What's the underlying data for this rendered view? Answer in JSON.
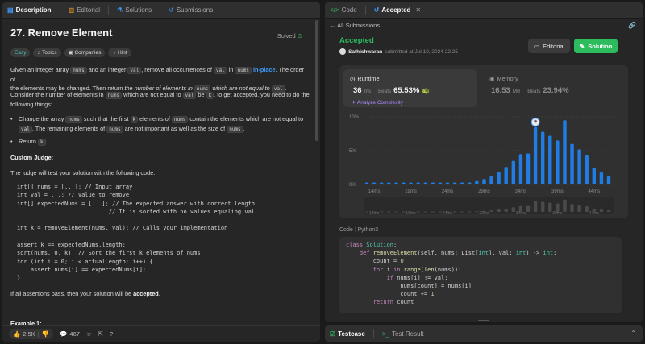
{
  "left": {
    "tabs": [
      "Description",
      "Editorial",
      "Solutions",
      "Submissions"
    ],
    "title": "27. Remove Element",
    "solved": "Solved",
    "tags": [
      "Easy",
      "Topics",
      "Companies",
      "Hint"
    ],
    "p1": {
      "a": "Given an integer array ",
      "c1": "nums",
      "b": " and an integer ",
      "c2": "val",
      "c": ", remove all occurrences of ",
      "c3": "val",
      "d": " in ",
      "c4": "nums",
      "e": " in-place",
      "f": ". The order of",
      "g": "the elements may be changed. Then return ",
      "h": "the number of elements in ",
      "c5": "nums",
      "i": " which are not equal to ",
      "c6": "val",
      "j": "."
    },
    "p2": {
      "a": "Consider the number of elements in ",
      "c1": "nums",
      "b": " which are not equal to ",
      "c2": "val",
      "c": " be ",
      "c3": "k",
      "d": ", to get accepted, you need to do the",
      "e": "following things:"
    },
    "bullet1": {
      "a": "Change the array ",
      "c1": "nums",
      "b": " such that the first ",
      "c2": "k",
      "c": " elements of ",
      "c3": "nums",
      "d": " contain the elements which are not equal to",
      "c4": "val",
      "e": ". The remaining elements of ",
      "c5": "nums",
      "f": " are not important as well as the size of ",
      "c6": "nums",
      "g": "."
    },
    "bullet2": {
      "a": "Return ",
      "c1": "k",
      "b": "."
    },
    "custom_judge": "Custom Judge:",
    "judge_text": "The judge will test your solution with the following code:",
    "judge_code": [
      "int[] nums = [...]; // Input array",
      "int val = ...; // Value to remove",
      "int[] expectedNums = [...]; // The expected answer with correct length.",
      "                           // It is sorted with no values equaling val.",
      "",
      "int k = removeElement(nums, val); // Calls your implementation",
      "",
      "assert k == expectedNums.length;",
      "sort(nums, 0, k); // Sort the first k elements of nums",
      "for (int i = 0; i < actualLength; i++) {",
      "    assert nums[i] == expectedNums[i];",
      "}"
    ],
    "pass_a": "If all assertions pass, then your solution will be ",
    "pass_b": "accepted",
    "pass_c": ".",
    "example": "Example 1:",
    "likes": "2.5K",
    "comments": "467"
  },
  "right": {
    "tabs": [
      "Code",
      "Accepted"
    ],
    "back": "All Submissions",
    "status": "Accepted",
    "user": "Sathishwaran",
    "submitted": "submitted at Jul 10, 2024 22:25",
    "editorial_btn": "Editorial",
    "solution_btn": "Solution",
    "runtime_label": "Runtime",
    "runtime_value": "36",
    "runtime_unit": "ms",
    "beats_label": "Beats",
    "runtime_pct": "65.53%",
    "analyze": "Analyze Complexity",
    "memory_label": "Memory",
    "memory_value": "16.53",
    "memory_unit": "MB",
    "memory_pct": "23.94%",
    "code_label": "Code",
    "lang": "Python3",
    "colors": {
      "accent_green": "#2cbb5d",
      "bar_blue": "#1e7ee6"
    }
  },
  "chart_data": {
    "type": "bar",
    "y_ticks": [
      "10%",
      "5%",
      "0%"
    ],
    "ylim": [
      0,
      10
    ],
    "x_ticks": [
      "14ms",
      "19ms",
      "24ms",
      "29ms",
      "34ms",
      "39ms",
      "44ms"
    ],
    "x": [
      13,
      14,
      15,
      16,
      17,
      18,
      19,
      20,
      21,
      22,
      23,
      24,
      25,
      26,
      27,
      28,
      29,
      30,
      31,
      32,
      33,
      34,
      35,
      36,
      37,
      38,
      39,
      40,
      41,
      42,
      43,
      44,
      45,
      46
    ],
    "values": [
      0.3,
      0.3,
      0.3,
      0.3,
      0.3,
      0.3,
      0.3,
      0.3,
      0.3,
      0.3,
      0.3,
      0.3,
      0.3,
      0.3,
      0.3,
      0.5,
      0.8,
      1.2,
      1.8,
      2.6,
      3.5,
      4.5,
      4.6,
      8.5,
      7.8,
      7.2,
      6.5,
      9.5,
      6.0,
      5.2,
      4.3,
      2.5,
      1.8,
      1.2
    ],
    "highlight_x": 36
  },
  "solution_code": [
    [
      "k:class ",
      "cl:Solution",
      "t::"
    ],
    [
      "t:    ",
      "k:def ",
      "f:removeElement",
      "t:(self, nums: List[",
      "cl:int",
      "t:], val: ",
      "cl:int",
      "t:) -> ",
      "cl:int",
      "t::"
    ],
    [
      "t:        count = ",
      "n:0"
    ],
    [
      "t:        ",
      "k:for ",
      "t:i ",
      "k:in ",
      "f:range",
      "t:(",
      "f:len",
      "t:(nums)):"
    ],
    [
      "t:            ",
      "k:if ",
      "t:nums[i] != val:"
    ],
    [
      "t:                nums[count] = nums[i]"
    ],
    [
      "t:                count += ",
      "n:1"
    ],
    [
      "t:        ",
      "k:return ",
      "t:count"
    ]
  ],
  "bottom": {
    "tabs": [
      "Testcase",
      "Test Result"
    ]
  }
}
